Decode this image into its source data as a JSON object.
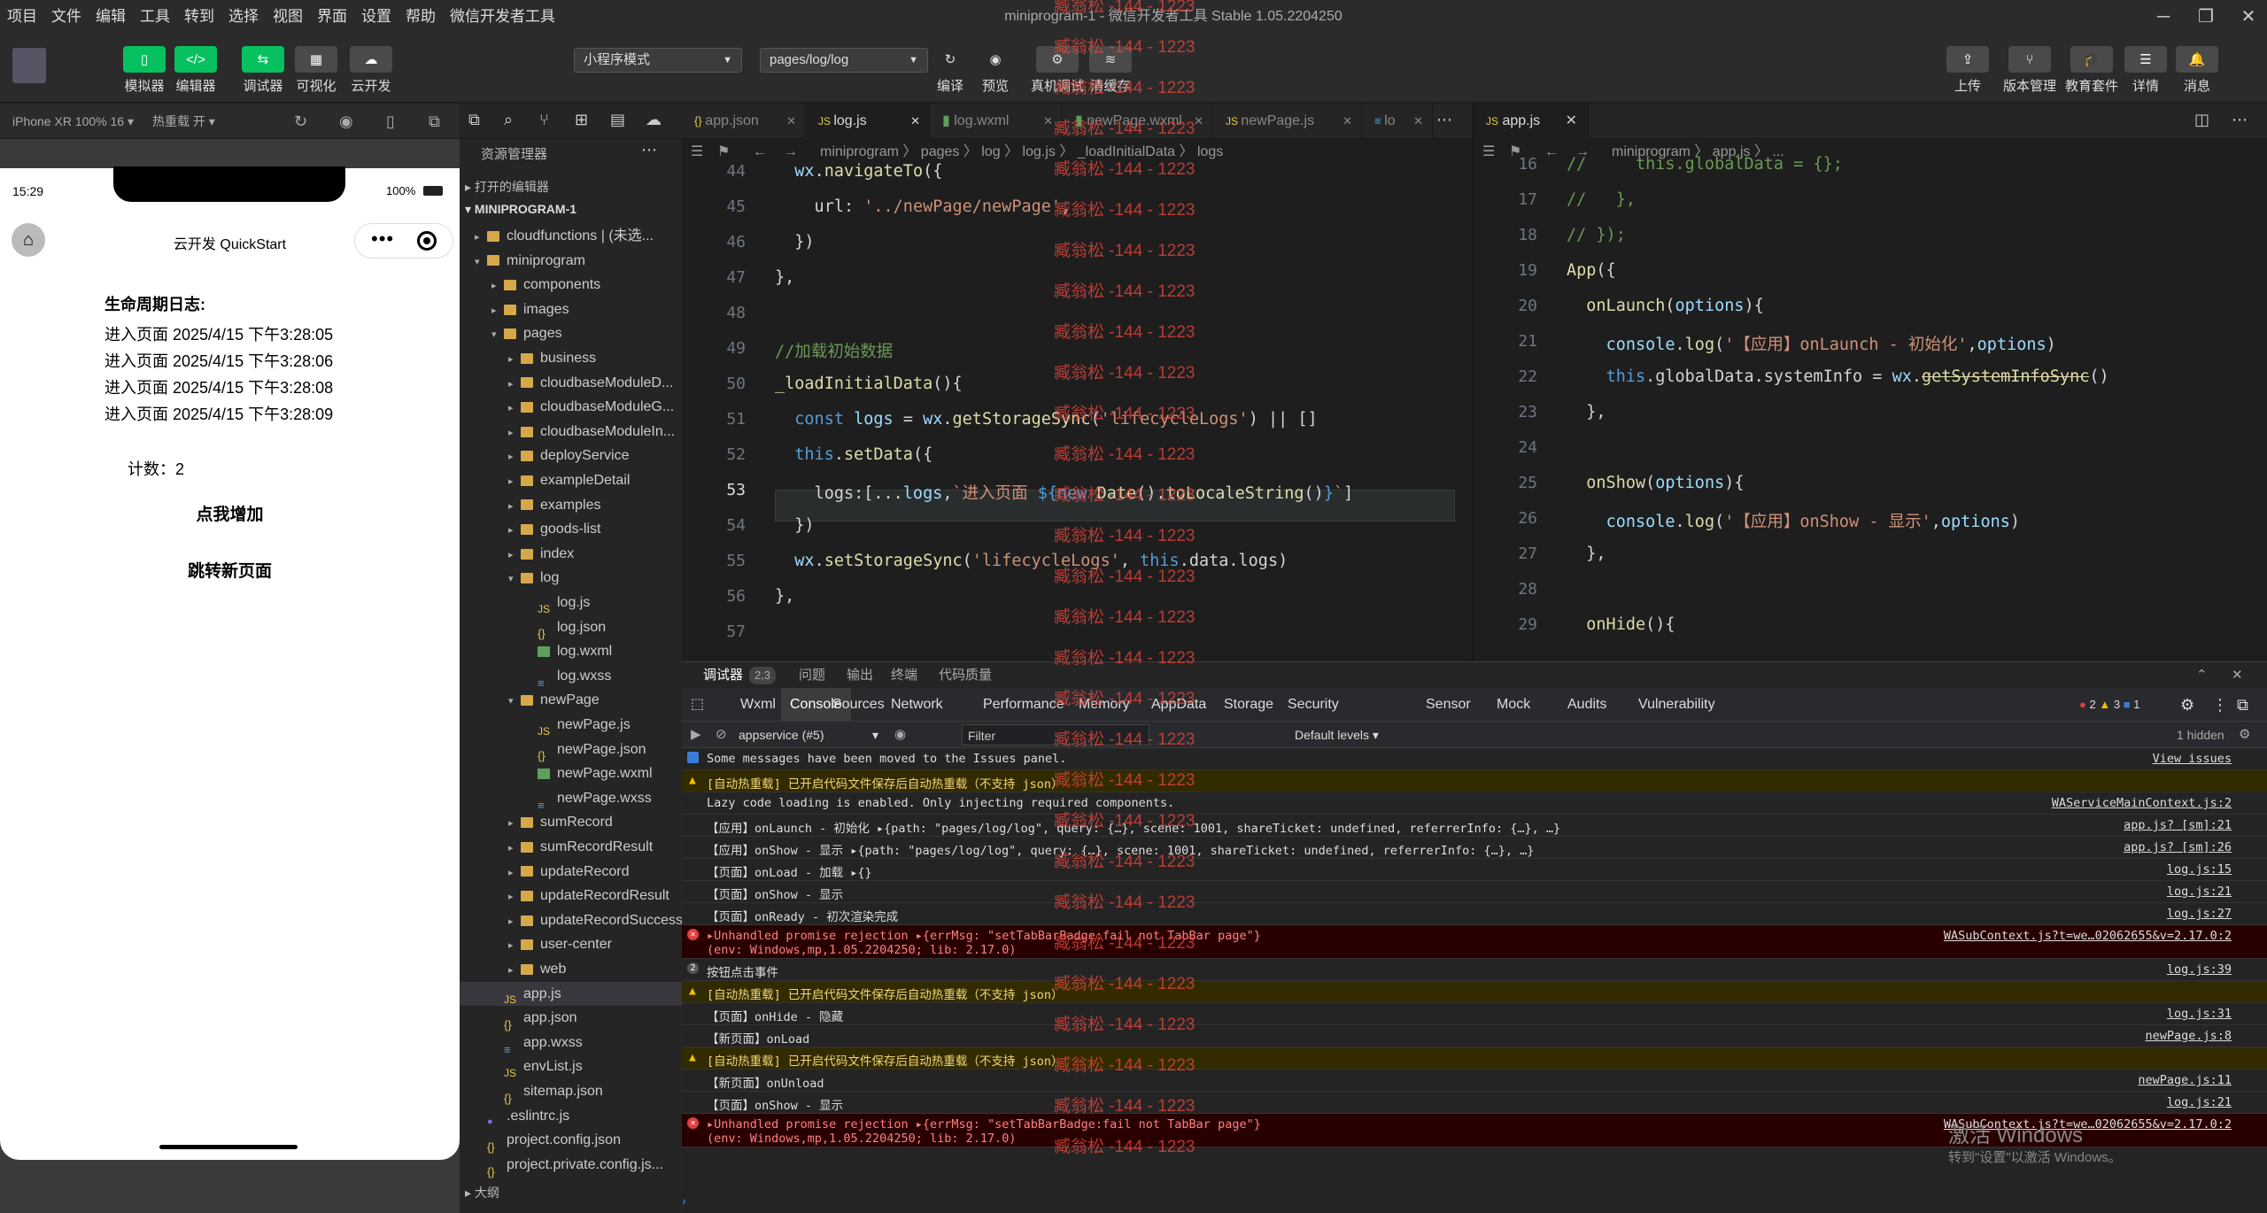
{
  "menu": [
    "项目",
    "文件",
    "编辑",
    "工具",
    "转到",
    "选择",
    "视图",
    "界面",
    "设置",
    "帮助",
    "微信开发者工具"
  ],
  "window_title": "miniprogram-1 - 微信开发者工具 Stable 1.05.2204250",
  "toolbar": {
    "left": [
      {
        "label": "模拟器",
        "glyph": "▯"
      },
      {
        "label": "编辑器",
        "glyph": "</>"
      },
      {
        "label": "调试器",
        "glyph": "⇆"
      },
      {
        "label": "可视化",
        "glyph": "▦"
      },
      {
        "label": "云开发",
        "glyph": "☁"
      }
    ],
    "mode_select": "小程序模式",
    "page_select": "pages/log/log",
    "mid": [
      {
        "label": "编译"
      },
      {
        "label": "预览"
      },
      {
        "label": "真机调试"
      },
      {
        "label": "清缓存"
      }
    ],
    "right": [
      {
        "label": "上传"
      },
      {
        "label": "版本管理"
      },
      {
        "label": "教育套件"
      },
      {
        "label": "详情"
      },
      {
        "label": "消息"
      }
    ]
  },
  "simbar": {
    "device": "iPhone XR 100% 16 ▾",
    "hotreload": "热重载 开 ▾"
  },
  "phone": {
    "time": "15:29",
    "battery": "100%",
    "nav_title": "云开发 QuickStart",
    "log_title": "生命周期日志:",
    "logs": [
      "进入页面 2025/4/15 下午3:28:05",
      "进入页面 2025/4/15 下午3:28:06",
      "进入页面 2025/4/15 下午3:28:08",
      "进入页面 2025/4/15 下午3:28:09"
    ],
    "counter": "计数：2",
    "btn_add": "点我增加",
    "btn_nav": "跳转新页面"
  },
  "explorer": {
    "title": "资源管理器",
    "open_editors": "打开的编辑器",
    "project": "MINIPROGRAM-1",
    "items": [
      {
        "label": "cloudfunctions | (未选...",
        "depth": 1,
        "type": "folder",
        "twist": "▸"
      },
      {
        "label": "miniprogram",
        "depth": 1,
        "type": "folder",
        "twist": "▾"
      },
      {
        "label": "components",
        "depth": 2,
        "type": "folder",
        "twist": "▸"
      },
      {
        "label": "images",
        "depth": 2,
        "type": "folder",
        "twist": "▸"
      },
      {
        "label": "pages",
        "depth": 2,
        "type": "folder",
        "twist": "▾"
      },
      {
        "label": "business",
        "depth": 3,
        "type": "folder",
        "twist": "▸"
      },
      {
        "label": "cloudbaseModuleD...",
        "depth": 3,
        "type": "folder",
        "twist": "▸"
      },
      {
        "label": "cloudbaseModuleG...",
        "depth": 3,
        "type": "folder",
        "twist": "▸"
      },
      {
        "label": "cloudbaseModuleIn...",
        "depth": 3,
        "type": "folder",
        "twist": "▸"
      },
      {
        "label": "deployService",
        "depth": 3,
        "type": "folder",
        "twist": "▸"
      },
      {
        "label": "exampleDetail",
        "depth": 3,
        "type": "folder",
        "twist": "▸"
      },
      {
        "label": "examples",
        "depth": 3,
        "type": "folder",
        "twist": "▸"
      },
      {
        "label": "goods-list",
        "depth": 3,
        "type": "folder",
        "twist": "▸"
      },
      {
        "label": "index",
        "depth": 3,
        "type": "folder",
        "twist": "▸"
      },
      {
        "label": "log",
        "depth": 3,
        "type": "folder",
        "twist": "▾"
      },
      {
        "label": "log.js",
        "depth": 4,
        "type": "js",
        "twist": ""
      },
      {
        "label": "log.json",
        "depth": 4,
        "type": "json",
        "twist": ""
      },
      {
        "label": "log.wxml",
        "depth": 4,
        "type": "wxml",
        "twist": ""
      },
      {
        "label": "log.wxss",
        "depth": 4,
        "type": "wxss",
        "twist": ""
      },
      {
        "label": "newPage",
        "depth": 3,
        "type": "folder",
        "twist": "▾"
      },
      {
        "label": "newPage.js",
        "depth": 4,
        "type": "js",
        "twist": ""
      },
      {
        "label": "newPage.json",
        "depth": 4,
        "type": "json",
        "twist": ""
      },
      {
        "label": "newPage.wxml",
        "depth": 4,
        "type": "wxml",
        "twist": ""
      },
      {
        "label": "newPage.wxss",
        "depth": 4,
        "type": "wxss",
        "twist": ""
      },
      {
        "label": "sumRecord",
        "depth": 3,
        "type": "folder",
        "twist": "▸"
      },
      {
        "label": "sumRecordResult",
        "depth": 3,
        "type": "folder",
        "twist": "▸"
      },
      {
        "label": "updateRecord",
        "depth": 3,
        "type": "folder",
        "twist": "▸"
      },
      {
        "label": "updateRecordResult",
        "depth": 3,
        "type": "folder",
        "twist": "▸"
      },
      {
        "label": "updateRecordSuccess",
        "depth": 3,
        "type": "folder",
        "twist": "▸"
      },
      {
        "label": "user-center",
        "depth": 3,
        "type": "folder",
        "twist": "▸"
      },
      {
        "label": "web",
        "depth": 3,
        "type": "folder",
        "twist": "▸"
      },
      {
        "label": "app.js",
        "depth": 2,
        "type": "js",
        "twist": "",
        "active": true
      },
      {
        "label": "app.json",
        "depth": 2,
        "type": "json",
        "twist": ""
      },
      {
        "label": "app.wxss",
        "depth": 2,
        "type": "wxss",
        "twist": ""
      },
      {
        "label": "envList.js",
        "depth": 2,
        "type": "js",
        "twist": ""
      },
      {
        "label": "sitemap.json",
        "depth": 2,
        "type": "json",
        "twist": ""
      },
      {
        "label": ".eslintrc.js",
        "depth": 1,
        "type": "dot",
        "twist": ""
      },
      {
        "label": "project.config.json",
        "depth": 1,
        "type": "json",
        "twist": ""
      },
      {
        "label": "project.private.config.js...",
        "depth": 1,
        "type": "json",
        "twist": ""
      }
    ],
    "outline": "大纲"
  },
  "editor1": {
    "tabs": [
      {
        "label": "app.json",
        "type": "json"
      },
      {
        "label": "log.js",
        "type": "js",
        "active": true
      },
      {
        "label": "log.wxml",
        "type": "wxml"
      },
      {
        "label": "newPage.wxml",
        "type": "wxml"
      },
      {
        "label": "newPage.js",
        "type": "js"
      },
      {
        "label": "lo",
        "type": "wxss"
      }
    ],
    "breadcrumb": "miniprogram 〉 pages 〉 log 〉 log.js 〉 _loadInitialData 〉 logs",
    "lines": [
      {
        "n": "44",
        "html": "  <span class='vr'>wx</span>.<span class='fn'>navigateTo</span>({"
      },
      {
        "n": "45",
        "html": "    url: <span class='st'>'../newPage/newPage'</span>,"
      },
      {
        "n": "46",
        "html": "  })"
      },
      {
        "n": "47",
        "html": "},"
      },
      {
        "n": "48",
        "html": ""
      },
      {
        "n": "49",
        "html": "<span class='cm'>//加载初始数据</span>"
      },
      {
        "n": "50",
        "html": "<span class='fn'>_loadInitialData</span>(){"
      },
      {
        "n": "51",
        "html": "  <span class='kw'>const</span> <span class='vr'>logs</span> = <span class='vr'>wx</span>.<span class='fn'>getStorageSync</span>(<span class='st'>'lifecycleLogs'</span>) || []"
      },
      {
        "n": "52",
        "html": "  <span class='kw'>this</span>.<span class='fn'>setData</span>({"
      },
      {
        "n": "53",
        "html": "    logs:[...<span class='vr'>logs</span>,<span class='st'>`进入页面 </span><span class='kw'>${new</span> <span class='fn'>Date</span>().<span class='fn'>toLocaleString</span>()<span class='kw'>}</span><span class='st'>`</span>]"
      },
      {
        "n": "54",
        "html": "  })"
      },
      {
        "n": "55",
        "html": "  <span class='vr'>wx</span>.<span class='fn'>setStorageSync</span>(<span class='st'>'lifecycleLogs'</span>, <span class='kw'>this</span>.data.logs)"
      },
      {
        "n": "56",
        "html": "},"
      },
      {
        "n": "57",
        "html": ""
      }
    ]
  },
  "editor2": {
    "tab": "app.js",
    "breadcrumb": "miniprogram 〉 app.js 〉 ...",
    "lines": [
      {
        "n": "16",
        "html": "<span class='cm'>//     this.globalData = {};</span>"
      },
      {
        "n": "17",
        "html": "<span class='cm'>//   },</span>"
      },
      {
        "n": "18",
        "html": "<span class='cm'>// });</span>"
      },
      {
        "n": "19",
        "html": "<span class='fn'>App</span>({"
      },
      {
        "n": "20",
        "html": "  <span class='fn'>onLaunch</span>(<span class='vr'>options</span>){"
      },
      {
        "n": "21",
        "html": "    <span class='vr'>console</span>.<span class='fn'>log</span>(<span class='st'>'【应用】onLaunch - 初始化'</span>,<span class='vr'>options</span>)"
      },
      {
        "n": "22",
        "html": "    <span class='kw'>this</span>.globalData.systemInfo = <span class='vr'>wx</span>.<span class='fn' style='text-decoration:line-through'>getSystemInfoSync</span>()"
      },
      {
        "n": "23",
        "html": "  },"
      },
      {
        "n": "24",
        "html": ""
      },
      {
        "n": "25",
        "html": "  <span class='fn'>onShow</span>(<span class='vr'>options</span>){"
      },
      {
        "n": "26",
        "html": "    <span class='vr'>console</span>.<span class='fn'>log</span>(<span class='st'>'【应用】onShow - 显示'</span>,<span class='vr'>options</span>)"
      },
      {
        "n": "27",
        "html": "  },"
      },
      {
        "n": "28",
        "html": ""
      },
      {
        "n": "29",
        "html": "  <span class='fn'>onHide</span>(){"
      }
    ]
  },
  "debugger": {
    "tabs": [
      "调试器",
      "2,3",
      "问题",
      "输出",
      "终端",
      "代码质量"
    ],
    "devtabs": [
      "Wxml",
      "Console",
      "Sources",
      "Network",
      "Performance",
      "Memory",
      "AppData",
      "Storage",
      "Security",
      "Sensor",
      "Mock",
      "Audits",
      "Vulnerability"
    ],
    "counts": {
      "errors": "2",
      "warnings": "3",
      "info": "1"
    },
    "context": "appservice (#5)",
    "filter_placeholder": "Filter",
    "levels": "Default levels ▾",
    "hidden": "1 hidden"
  },
  "console": [
    {
      "type": "info",
      "text": "Some messages have been moved to the Issues panel.",
      "src": "View issues"
    },
    {
      "type": "warn",
      "text": "[自动热重载] 已开启代码文件保存后自动热重载（不支持 json）",
      "src": ""
    },
    {
      "type": "log",
      "text": "Lazy code loading is enabled. Only injecting required components.",
      "src": "WAServiceMainContext.js:2"
    },
    {
      "type": "log",
      "text": "【应用】onLaunch - 初始化 ▸{path: \"pages/log/log\", query: {…}, scene: 1001, shareTicket: undefined, referrerInfo: {…}, …}",
      "src": "app.js? [sm]:21"
    },
    {
      "type": "log",
      "text": "【应用】onShow - 显示 ▸{path: \"pages/log/log\", query: {…}, scene: 1001, shareTicket: undefined, referrerInfo: {…}, …}",
      "src": "app.js? [sm]:26"
    },
    {
      "type": "log",
      "text": "【页面】onLoad - 加载 ▸{}",
      "src": "log.js:15"
    },
    {
      "type": "log",
      "text": "【页面】onShow - 显示",
      "src": "log.js:21"
    },
    {
      "type": "log",
      "text": "【页面】onReady - 初次渲染完成",
      "src": "log.js:27"
    },
    {
      "type": "err",
      "text": "▸Unhandled promise rejection ▸{errMsg: \"setTabBarBadge:fail not TabBar page\"}",
      "text2": "(env: Windows,mp,1.05.2204250; lib: 2.17.0)",
      "src": "WASubContext.js?t=we…02062655&v=2.17.0:2"
    },
    {
      "type": "log2",
      "text": "按钮点击事件",
      "src": "log.js:39"
    },
    {
      "type": "warn",
      "text": "[自动热重载] 已开启代码文件保存后自动热重载（不支持 json）",
      "src": ""
    },
    {
      "type": "log",
      "text": "【页面】onHide - 隐藏",
      "src": "log.js:31"
    },
    {
      "type": "log",
      "text": "【新页面】onLoad",
      "src": "newPage.js:8"
    },
    {
      "type": "warn",
      "text": "[自动热重载] 已开启代码文件保存后自动热重载（不支持 json）",
      "src": ""
    },
    {
      "type": "log",
      "text": "【新页面】onUnload",
      "src": "newPage.js:11"
    },
    {
      "type": "log",
      "text": "【页面】onShow - 显示",
      "src": "log.js:21"
    },
    {
      "type": "err",
      "text": "▸Unhandled promise rejection ▸{errMsg: \"setTabBarBadge:fail not TabBar page\"}",
      "text2": "(env: Windows,mp,1.05.2204250; lib: 2.17.0)",
      "src": "WASubContext.js?t=we…02062655&v=2.17.0:2"
    }
  ],
  "watermark": "臧翁松 -144 - 1223",
  "activation": {
    "line1": "激活 Windows",
    "line2": "转到\"设置\"以激活 Windows。"
  },
  "colors": {
    "accent": "#07c160",
    "error_bg": "#290000",
    "warn_bg": "#332b00"
  }
}
